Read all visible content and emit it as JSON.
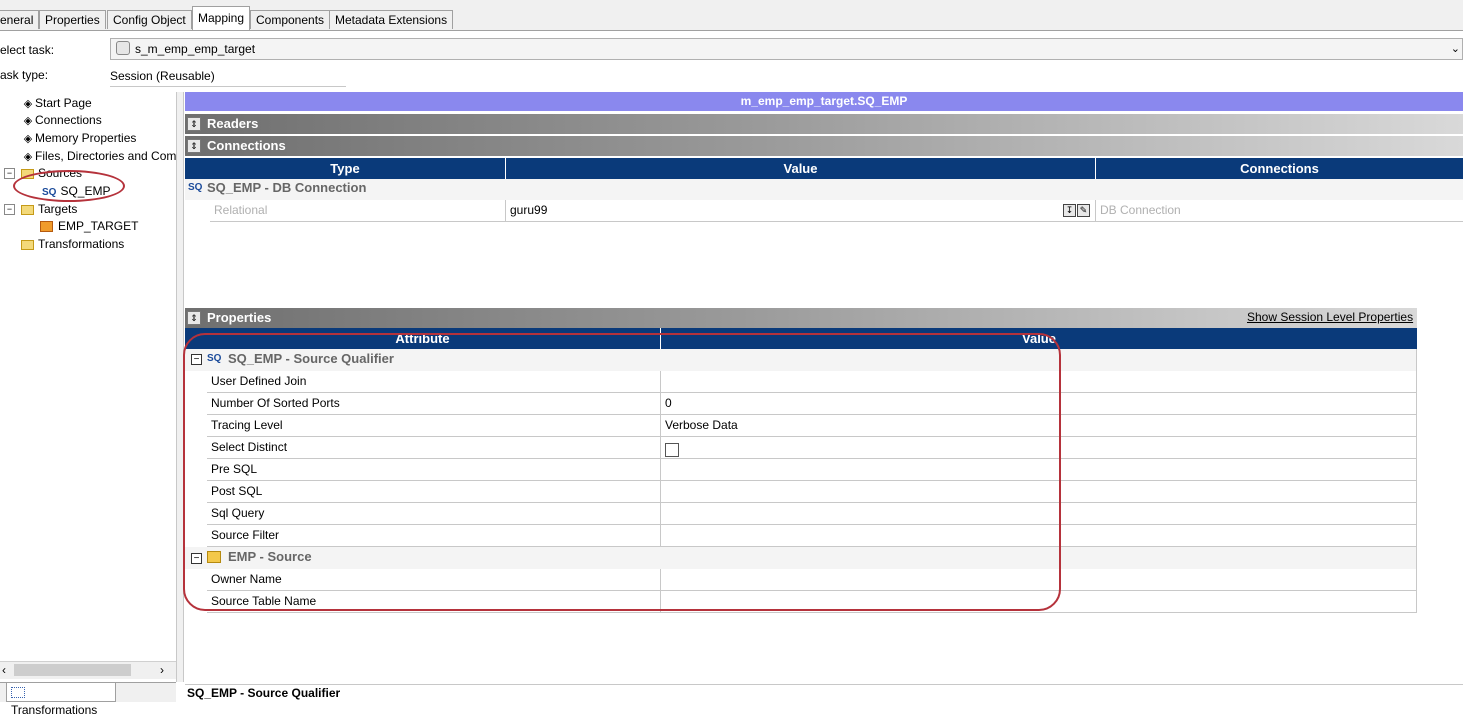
{
  "tabs": [
    "eneral",
    "Properties",
    "Config Object",
    "Mapping",
    "Components",
    "Metadata Extensions"
  ],
  "active_tab": "Mapping",
  "task": {
    "select_label": "elect task:",
    "select_value": "s_m_emp_emp_target",
    "type_label": "ask type:",
    "type_value": "Session (Reusable)"
  },
  "tree": {
    "start_page": "Start Page",
    "connections": "Connections",
    "memory": "Memory Properties",
    "files": "Files, Directories and Com",
    "sources": "Sources",
    "sq_emp": "SQ_EMP",
    "sq_badge": "SQ",
    "targets": "Targets",
    "emp_target": "EMP_TARGET",
    "transformations": "Transformations"
  },
  "bottom_tab": "Transformations",
  "mapping_title": "m_emp_emp_target.SQ_EMP",
  "readers_label": "Readers",
  "connections_section": {
    "label": "Connections",
    "headers": [
      "Type",
      "Value",
      "Connections"
    ],
    "group": "SQ_EMP - DB Connection",
    "group_badge": "SQ",
    "row": {
      "type": "Relational",
      "value": "guru99",
      "connection": "DB Connection"
    }
  },
  "properties_section": {
    "label": "Properties",
    "show_link": "Show Session Level Properties",
    "headers": [
      "Attribute",
      "Value"
    ],
    "group1": "SQ_EMP - Source Qualifier",
    "group1_badge": "SQ",
    "rows1": [
      {
        "attr": "User Defined Join",
        "value": ""
      },
      {
        "attr": "Number Of Sorted Ports",
        "value": "0"
      },
      {
        "attr": "Tracing Level",
        "value": "Verbose Data"
      },
      {
        "attr": "Select Distinct",
        "value": ""
      },
      {
        "attr": "Pre SQL",
        "value": ""
      },
      {
        "attr": "Post SQL",
        "value": ""
      },
      {
        "attr": "Sql Query",
        "value": ""
      },
      {
        "attr": "Source Filter",
        "value": ""
      }
    ],
    "group2": "EMP - Source",
    "rows2": [
      {
        "attr": "Owner Name",
        "value": ""
      },
      {
        "attr": "Source Table Name",
        "value": ""
      }
    ]
  },
  "status_text": "SQ_EMP - Source Qualifier",
  "colors": {
    "header_blue": "#0a3a7a",
    "title_purple": "#8a88ee",
    "annotation_red": "#b5323b"
  }
}
